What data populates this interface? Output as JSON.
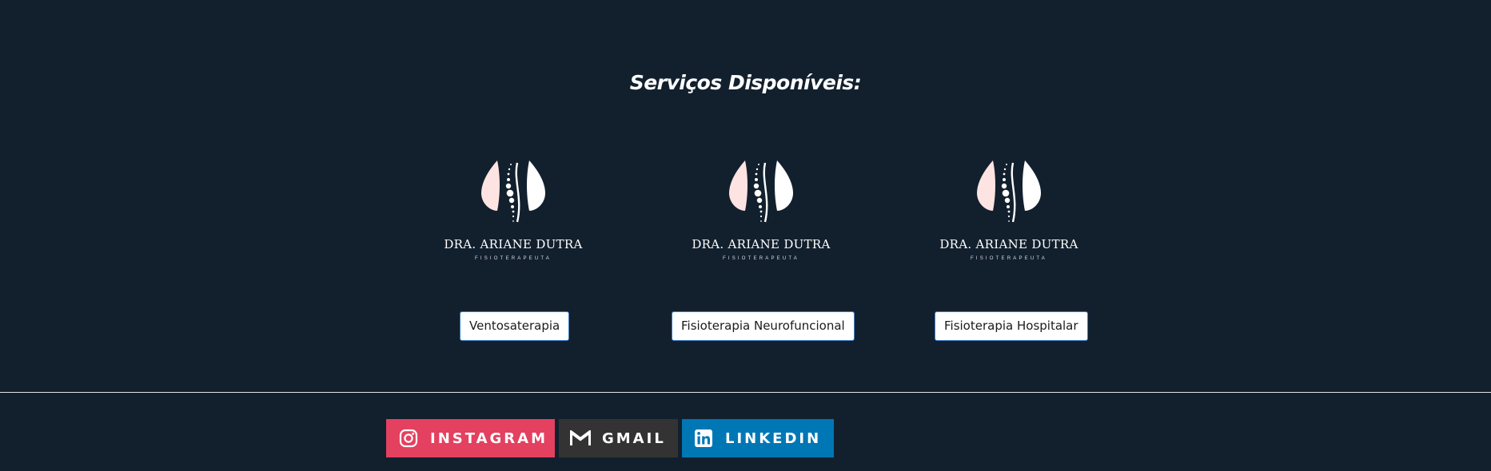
{
  "section": {
    "title": "Serviços Disponíveis:"
  },
  "services": [
    {
      "brand_name": "DRA. ARIANE DUTRA",
      "brand_sub": "FISIOTERAPEUTA",
      "button_label": "Ventosaterapia"
    },
    {
      "brand_name": "DRA. ARIANE DUTRA",
      "brand_sub": "FISIOTERAPEUTA",
      "button_label": "Fisioterapia Neurofuncional"
    },
    {
      "brand_name": "DRA. ARIANE DUTRA",
      "brand_sub": "FISIOTERAPEUTA",
      "button_label": "Fisioterapia Hospitalar"
    }
  ],
  "social": [
    {
      "label": "INSTAGRAM",
      "icon": "instagram-icon",
      "color": "#e4405f"
    },
    {
      "label": "GMAIL",
      "icon": "gmail-icon",
      "color": "#333333"
    },
    {
      "label": "LINKEDIN",
      "icon": "linkedin-icon",
      "color": "#0077b5"
    }
  ],
  "colors": {
    "background": "#12202e",
    "logo_pink": "#fde3e1",
    "logo_white": "#ffffff"
  }
}
